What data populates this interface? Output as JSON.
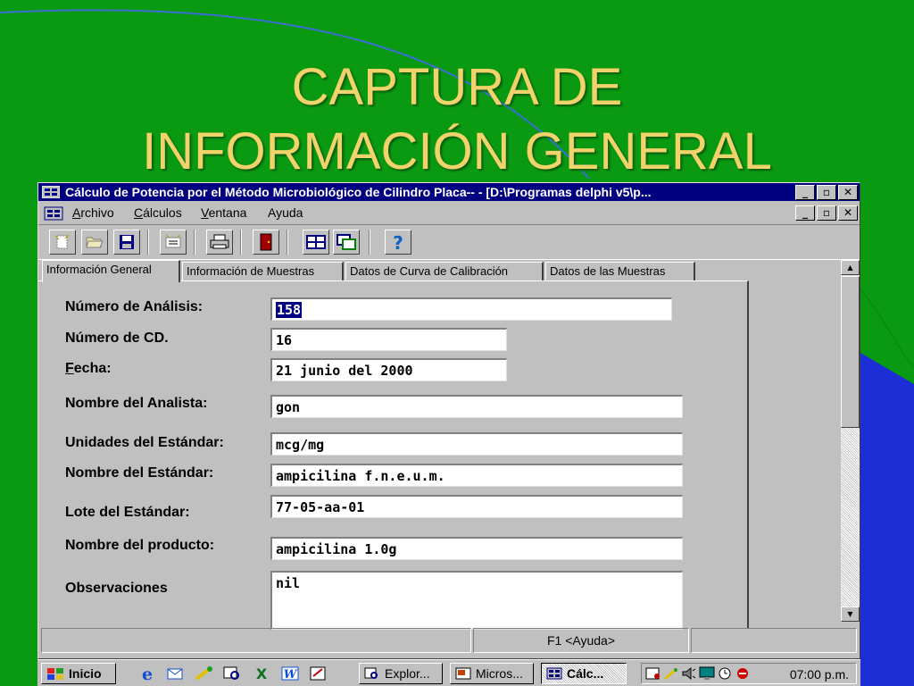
{
  "slide": {
    "title_line1": "CAPTURA DE",
    "title_line2": "INFORMACIÓN GENERAL"
  },
  "window": {
    "title": "Cálculo de Potencia por el Método Microbiológico de Cilindro Placa-- - [D:\\Programas delphi v5\\p...",
    "buttons": {
      "minimize": "_",
      "restore": "▫",
      "close": "✕"
    }
  },
  "menu": {
    "items": [
      {
        "accel": "A",
        "rest": "rchivo"
      },
      {
        "accel": "C",
        "rest": "álculos"
      },
      {
        "accel": "V",
        "rest": "entana"
      },
      {
        "accel": "",
        "rest": "Ayuda"
      }
    ]
  },
  "tabs": [
    {
      "label": "Información General",
      "active": true
    },
    {
      "label": "Información de Muestras",
      "active": false
    },
    {
      "label": "Datos de Curva de Calibración",
      "active": false
    },
    {
      "label": "Datos de las Muestras",
      "active": false
    }
  ],
  "form": {
    "numero_analisis": {
      "label": "Número de Análisis:",
      "value": "158"
    },
    "numero_cd": {
      "label": "Número de CD.",
      "value": "16"
    },
    "fecha": {
      "label_accel": "F",
      "label_rest": "echa:",
      "value": "21 junio del 2000"
    },
    "nombre_analista": {
      "label": "Nombre del Analista:",
      "value": "gon"
    },
    "unidades_estandar": {
      "label": "Unidades del Estándar:",
      "value": "mcg/mg"
    },
    "nombre_estandar": {
      "label": "Nombre del Estándar:",
      "value": "ampicilina f.n.e.u.m."
    },
    "lote_estandar": {
      "label": "Lote del Estándar:",
      "value": "77-05-aa-01"
    },
    "nombre_producto": {
      "label": "Nombre del producto:",
      "value": "ampicilina 1.0g"
    },
    "observaciones": {
      "label": "Observaciones",
      "value": "nil"
    }
  },
  "status": {
    "help": "F1 <Ayuda>"
  },
  "taskbar": {
    "start": "Inicio",
    "tasks": [
      {
        "label": "Explor...",
        "pressed": false
      },
      {
        "label": "Micros...",
        "pressed": false
      },
      {
        "label": "Cálc...",
        "pressed": true
      }
    ],
    "clock": "07:00 p.m."
  },
  "colors": {
    "slide_bg": "#0a9a12",
    "slide_title": "#f2d36b",
    "titlebar": "#000080",
    "face": "#c0c0c0"
  }
}
